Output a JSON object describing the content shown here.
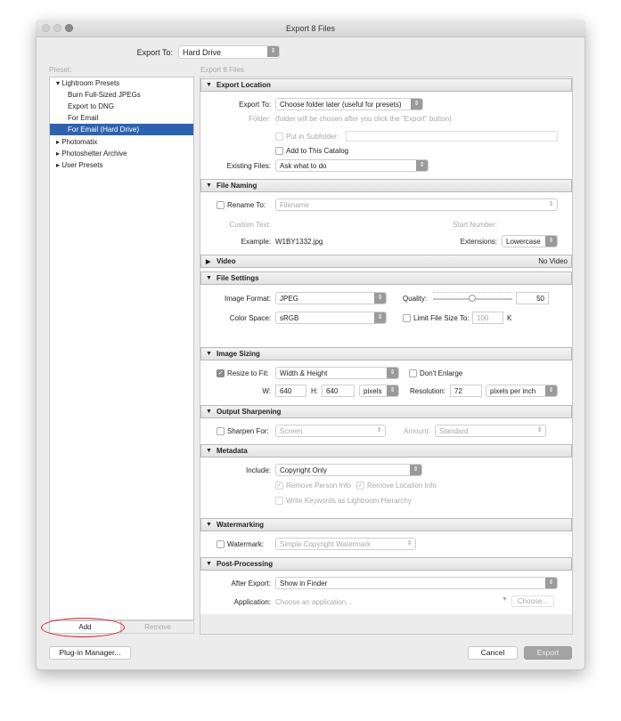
{
  "window": {
    "title": "Export 8 Files"
  },
  "export_to": {
    "label": "Export To:",
    "value": "Hard Drive"
  },
  "preset": {
    "label": "Preset:",
    "items": [
      {
        "label": "Lightroom Presets",
        "type": "folder",
        "expanded": true
      },
      {
        "label": "Burn Full-Sized JPEGs",
        "type": "preset"
      },
      {
        "label": "Export to DNG",
        "type": "preset"
      },
      {
        "label": "For Email",
        "type": "preset"
      },
      {
        "label": "For Email (Hard Drive)",
        "type": "preset",
        "selected": true
      },
      {
        "label": "Photomatix",
        "type": "folder",
        "expanded": false
      },
      {
        "label": "Photoshelter Archive",
        "type": "folder",
        "expanded": false
      },
      {
        "label": "User Presets",
        "type": "folder",
        "expanded": false
      }
    ],
    "add_label": "Add",
    "remove_label": "Remove"
  },
  "panel_title": "Export 8 Files",
  "export_location": {
    "title": "Export Location",
    "export_to_label": "Export To:",
    "export_to_value": "Choose folder later (useful for presets)",
    "folder_label": "Folder:",
    "folder_value": "(folder will be chosen after you click the \"Export\" button)",
    "subfolder_label": "Put in Subfolder:",
    "add_catalog_label": "Add to This Catalog",
    "existing_label": "Existing Files:",
    "existing_value": "Ask what to do"
  },
  "file_naming": {
    "title": "File Naming",
    "rename_label": "Rename To:",
    "rename_value": "Filename",
    "custom_text_label": "Custom Text:",
    "start_number_label": "Start Number:",
    "example_label": "Example:",
    "example_value": "W1BY1332.jpg",
    "extensions_label": "Extensions:",
    "extensions_value": "Lowercase"
  },
  "video": {
    "title": "Video",
    "status": "No Video"
  },
  "file_settings": {
    "title": "File Settings",
    "format_label": "Image Format:",
    "format_value": "JPEG",
    "quality_label": "Quality:",
    "quality_value": "50",
    "color_space_label": "Color Space:",
    "color_space_value": "sRGB",
    "limit_label": "Limit File Size To:",
    "limit_value": "100",
    "limit_unit": "K"
  },
  "image_sizing": {
    "title": "Image Sizing",
    "resize_label": "Resize to Fit:",
    "resize_value": "Width & Height",
    "dont_enlarge_label": "Don't Enlarge",
    "w_label": "W:",
    "w_value": "640",
    "h_label": "H:",
    "h_value": "640",
    "unit_value": "pixels",
    "resolution_label": "Resolution:",
    "resolution_value": "72",
    "resolution_unit": "pixels per inch"
  },
  "output_sharpening": {
    "title": "Output Sharpening",
    "sharpen_label": "Sharpen For:",
    "sharpen_value": "Screen",
    "amount_label": "Amount:",
    "amount_value": "Standard"
  },
  "metadata": {
    "title": "Metadata",
    "include_label": "Include:",
    "include_value": "Copyright Only",
    "remove_person_label": "Remove Person Info",
    "remove_location_label": "Remove Location Info",
    "write_keywords_label": "Write Keywords as Lightroom Hierarchy"
  },
  "watermarking": {
    "title": "Watermarking",
    "watermark_label": "Watermark:",
    "watermark_value": "Simple Copyright Watermark"
  },
  "post_processing": {
    "title": "Post-Processing",
    "after_label": "After Export:",
    "after_value": "Show in Finder",
    "app_label": "Application:",
    "app_placeholder": "Choose an application...",
    "choose_label": "Choose..."
  },
  "footer": {
    "plugin_label": "Plug-in Manager...",
    "cancel_label": "Cancel",
    "export_label": "Export"
  },
  "colors": {
    "selection": "#2d62b0",
    "highlight_ring": "#d0202a"
  }
}
